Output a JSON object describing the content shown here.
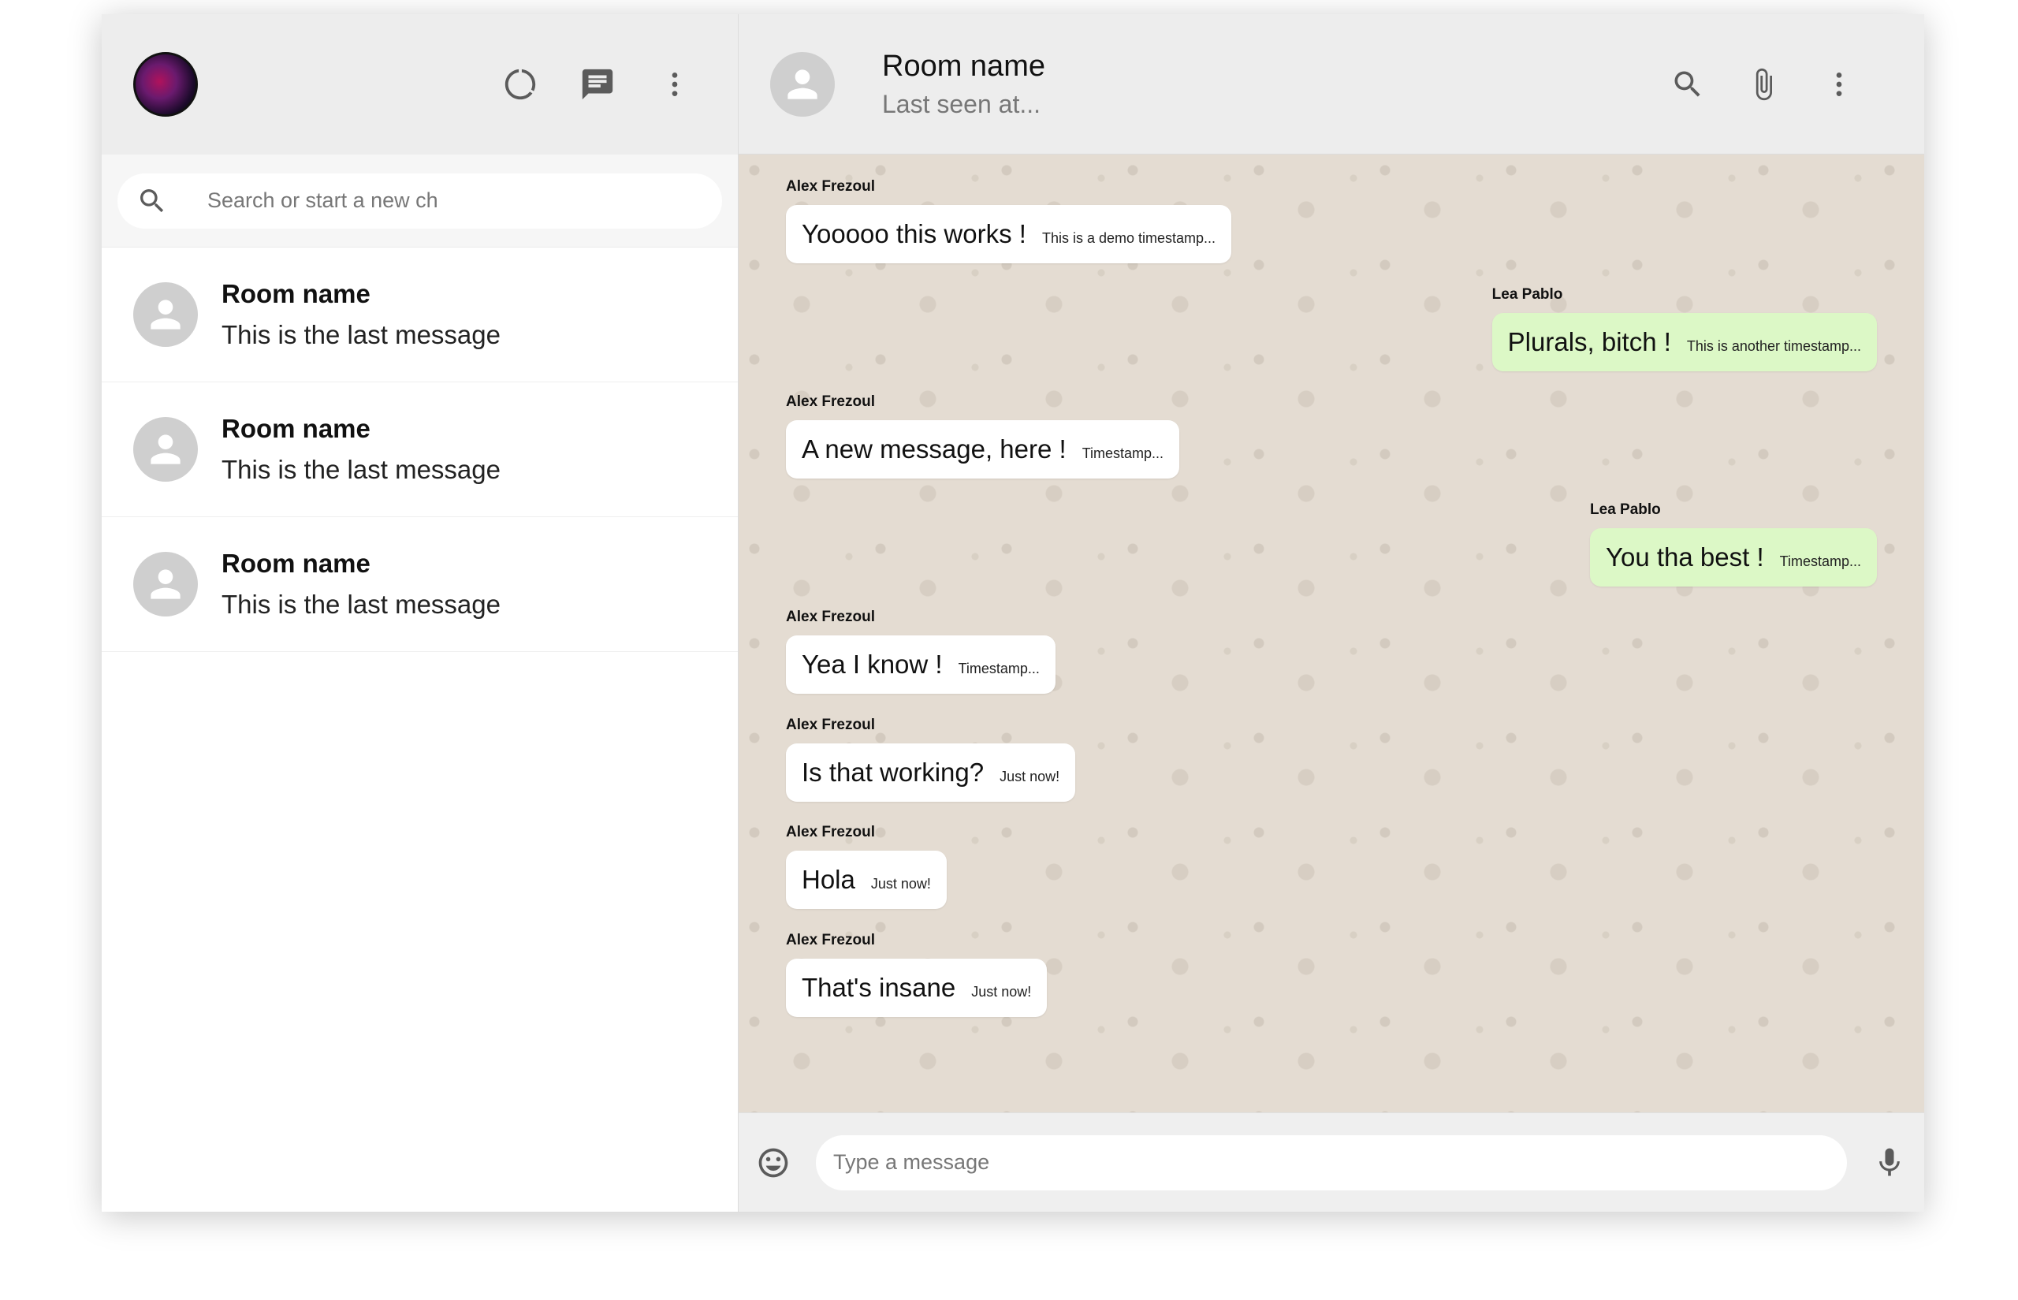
{
  "sidebar": {
    "search_placeholder": "Search or start a new ch",
    "rooms": [
      {
        "name": "Room name",
        "last_message": "This is the last message"
      },
      {
        "name": "Room name",
        "last_message": "This is the last message"
      },
      {
        "name": "Room name",
        "last_message": "This is the last message"
      }
    ],
    "icons": [
      "status-icon",
      "chat-icon",
      "more-vert-icon"
    ]
  },
  "chat": {
    "title": "Room name",
    "subtitle": "Last seen at...",
    "icons": [
      "search-icon",
      "attach-icon",
      "more-vert-icon"
    ],
    "messages": [
      {
        "sender": "Alex Frezoul",
        "text": "Yooooo this works !",
        "time": "This is a demo timestamp...",
        "outgoing": false
      },
      {
        "sender": "Lea Pablo",
        "text": "Plurals, bitch !",
        "time": "This is another timestamp...",
        "outgoing": true
      },
      {
        "sender": "Alex Frezoul",
        "text": "A new message, here !",
        "time": "Timestamp...",
        "outgoing": false
      },
      {
        "sender": "Lea Pablo",
        "text": "You tha best !",
        "time": "Timestamp...",
        "outgoing": true
      },
      {
        "sender": "Alex Frezoul",
        "text": "Yea I know !",
        "time": "Timestamp...",
        "outgoing": false
      },
      {
        "sender": "Alex Frezoul",
        "text": "Is that working?",
        "time": "Just now!",
        "outgoing": false
      },
      {
        "sender": "Alex Frezoul",
        "text": "Hola",
        "time": "Just now!",
        "outgoing": false
      },
      {
        "sender": "Alex Frezoul",
        "text": "That's insane",
        "time": "Just now!",
        "outgoing": false
      }
    ],
    "input_placeholder": "Type a message"
  },
  "colors": {
    "header_bg": "#ededed",
    "chat_bg": "#e4dcd2",
    "outgoing_bubble": "#dcf8c6",
    "incoming_bubble": "#ffffff"
  }
}
